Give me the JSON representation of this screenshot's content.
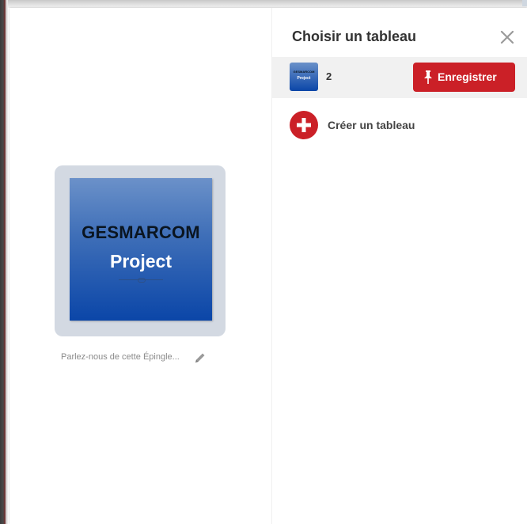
{
  "pin": {
    "image_title_line1": "GESMARCOM",
    "image_title_line2": "Project",
    "description_placeholder": "Parlez-nous de cette Épingle..."
  },
  "panel": {
    "title": "Choisir un tableau",
    "close_icon": "close-icon",
    "boards": [
      {
        "name": "2",
        "thumb_line1": "GESMARCOM",
        "thumb_line2": "Project",
        "save_label": "Enregistrer",
        "save_icon": "pushpin-icon"
      }
    ],
    "create_board_label": "Créer un tableau",
    "create_board_icon": "plus-circle-icon"
  },
  "colors": {
    "accent": "#cb2027",
    "board_row_bg": "#f1f1f1",
    "pin_frame": "#d3d9e2",
    "pin_image_top": "#6b91c9",
    "pin_image_bottom": "#0b46a8"
  }
}
